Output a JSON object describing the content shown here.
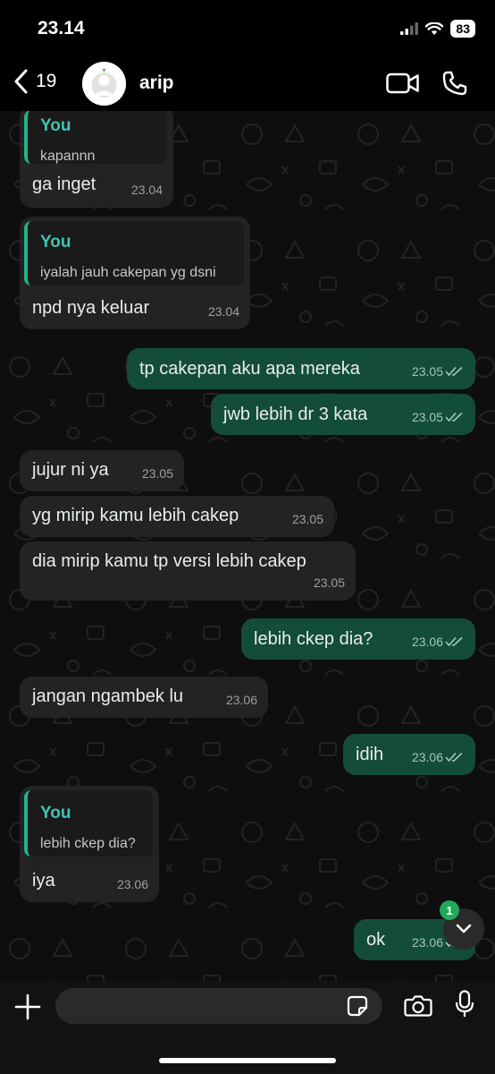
{
  "status_bar": {
    "time": "23.14",
    "battery": "83"
  },
  "header": {
    "back_count": "19",
    "contact_name": "arip"
  },
  "messages": [
    {
      "dir": "in",
      "quote": {
        "author": "You",
        "text": "kapannn"
      },
      "text": "ga inget",
      "time": "23.04"
    },
    {
      "dir": "in",
      "quote": {
        "author": "You",
        "text": "iyalah jauh cakepan yg dsni"
      },
      "text": "npd nya keluar",
      "time": "23.04"
    },
    {
      "dir": "out",
      "text": "tp cakepan aku apa mereka",
      "time": "23.05"
    },
    {
      "dir": "out",
      "text": "jwb lebih dr 3 kata",
      "time": "23.05"
    },
    {
      "dir": "in",
      "text": "jujur ni ya",
      "time": "23.05"
    },
    {
      "dir": "in",
      "text": "yg mirip kamu lebih cakep",
      "time": "23.05"
    },
    {
      "dir": "in",
      "text": "dia mirip kamu tp versi lebih cakep",
      "time": "23.05"
    },
    {
      "dir": "out",
      "text": "lebih ckep dia?",
      "time": "23.06"
    },
    {
      "dir": "in",
      "text": "jangan ngambek lu",
      "time": "23.06"
    },
    {
      "dir": "out",
      "text": "idih",
      "time": "23.06"
    },
    {
      "dir": "in",
      "quote": {
        "author": "You",
        "text": "lebih ckep dia?"
      },
      "text": "iya",
      "time": "23.06"
    },
    {
      "dir": "out",
      "text": "ok",
      "time": "23.06"
    }
  ],
  "scroll": {
    "unread_count": "1"
  },
  "composer": {
    "placeholder": ""
  },
  "colors": {
    "incoming": "#232323",
    "outgoing": "#144d37",
    "accent": "#21b38e"
  }
}
